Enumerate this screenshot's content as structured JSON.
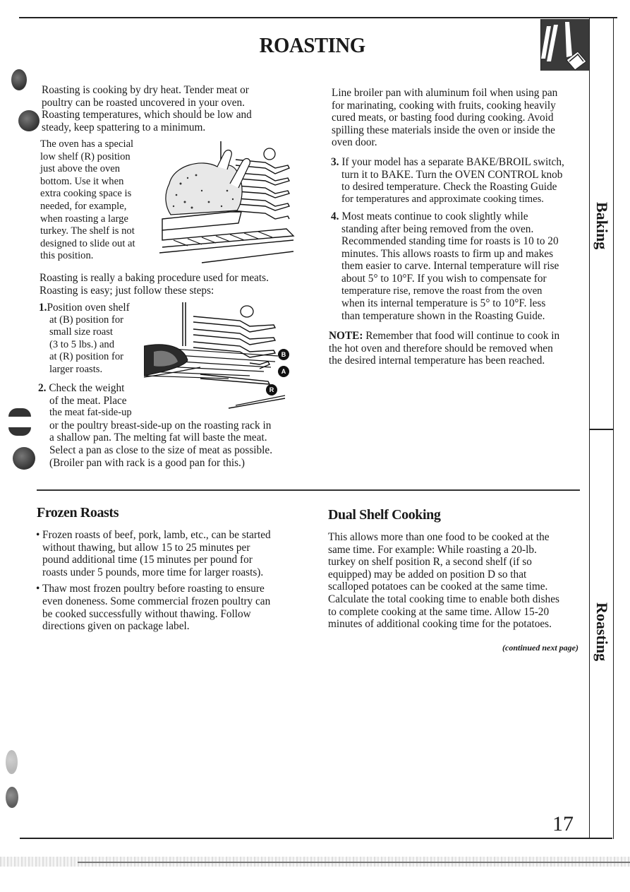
{
  "page": {
    "title": "ROASTING",
    "page_number": "17",
    "side_tabs": [
      "Baking",
      "Roasting"
    ],
    "continued_note": "(continued next page)"
  },
  "left_column": {
    "intro": "Roasting is cooking by dry heat. Tender meat or poultry can be roasted uncovered in your oven. Roasting temperatures, which should be low and steady, keep spattering to a minimum.",
    "intro_lines": [
      "Roasting is cooking by dry heat. Tender meat or",
      "poultry can be roasted uncovered in your oven.",
      "Roasting temperatures, which should be low and",
      "steady, keep spattering to a minimum."
    ],
    "special_shelf_lines": [
      "The oven has a special",
      "low shelf (R) position",
      "just above the oven",
      "bottom. Use it when",
      "extra cooking space is",
      "needed, for example,",
      "when roasting a large",
      "turkey. The shelf is not",
      "designed to slide out at",
      "this position."
    ],
    "baking_procedure_lines": [
      "Roasting is really a baking procedure used for meats.",
      "Roasting is easy; just follow these steps:"
    ],
    "steps": [
      {
        "number": "1.",
        "lines": [
          "Position oven shelf",
          "at (B) position for",
          "small size roast",
          "(3 to 5 lbs.) and",
          "at (R) position for",
          "larger roasts."
        ]
      },
      {
        "number": "2.",
        "lines": [
          "Check the weight",
          "of the meat. Place",
          "the meat fat-side-up",
          "or the poultry breast-side-up on the roasting rack in",
          "a shallow pan. The melting fat will baste the meat.",
          "Select a pan as close to the size of meat as possible.",
          "(Broiler pan with rack is a good pan for this.)"
        ]
      }
    ],
    "figure_turkey": {
      "label": "turkey-on-low-shelf-illustration",
      "marker": "O"
    },
    "figure_roast": {
      "label": "roast-shelf-positions-illustration",
      "marker": "O",
      "positions": [
        "B",
        "A",
        "R"
      ]
    }
  },
  "right_column": {
    "foil_lines": [
      "Line broiler pan with aluminum foil when using pan",
      "for marinating, cooking with fruits, cooking heavily",
      "cured meats, or basting food during cooking. Avoid",
      "spilling these materials inside the oven or inside the",
      "oven door."
    ],
    "steps": [
      {
        "number": "3.",
        "lines": [
          "If your model has a separate BAKE/BROIL switch,",
          "turn it to BAKE. Turn the OVEN CONTROL knob",
          "to desired temperature. Check the Roasting Guide",
          "for temperatures and approximate cooking times."
        ]
      },
      {
        "number": "4.",
        "lines": [
          "Most meats continue to cook slightly while",
          "standing after being removed from the oven.",
          "Recommended standing time for roasts is 10 to 20",
          "minutes. This allows roasts to firm up and makes",
          "them easier to carve. Internal temperature will rise",
          "about 5° to 10°F. If you wish to compensate for",
          "temperature rise, remove the roast from the oven",
          "when its internal temperature is 5° to 10°F. less",
          "than temperature shown in the Roasting Guide."
        ]
      }
    ],
    "note_label": "NOTE:",
    "note_lines": [
      " Remember that food will continue to cook in",
      "the hot oven and therefore should be removed when",
      "the desired internal temperature has been reached."
    ]
  },
  "frozen_roasts": {
    "heading": "Frozen Roasts",
    "bullets": [
      [
        "Frozen roasts of beef, pork, lamb, etc., can be started",
        "without thawing, but allow 15 to 25 minutes per",
        "pound additional time (15 minutes per pound for",
        "roasts under 5 pounds, more time for larger roasts)."
      ],
      [
        "Thaw most frozen poultry before roasting to ensure",
        "even doneness. Some commercial frozen poultry can",
        "be cooked successfully without thawing. Follow",
        "directions given on package label."
      ]
    ]
  },
  "dual_shelf": {
    "heading": "Dual Shelf Cooking",
    "lines": [
      "This allows more than one food to be cooked at the",
      "same time. For example: While roasting a 20-lb.",
      "turkey on shelf position R, a second shelf (if so",
      "equipped) may be added on position D so that",
      "scalloped potatoes can be cooked at the same time.",
      "Calculate the total cooking time to enable both dishes",
      "to complete cooking at the same time. Allow 15-20",
      "minutes of additional cooking time for the potatoes."
    ]
  },
  "bullet_glyph": "•"
}
